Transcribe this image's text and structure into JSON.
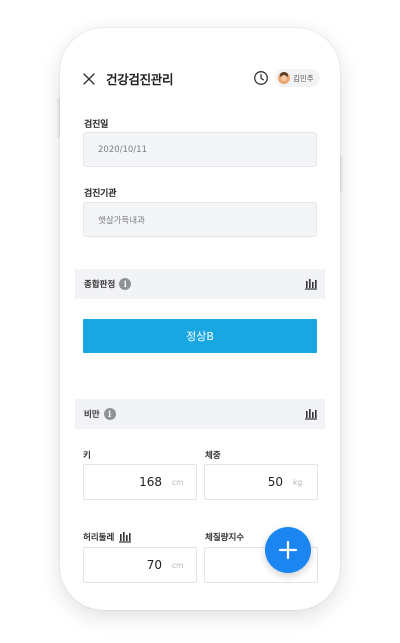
{
  "header": {
    "title": "건강검진관리",
    "user_name": "김민주"
  },
  "form": {
    "exam_date": {
      "label": "검진일",
      "value": "2020/10/11"
    },
    "institution": {
      "label": "검진기관",
      "value": "햇살가득내과"
    }
  },
  "overall": {
    "section_title": "종합판정",
    "result_label": "정상B"
  },
  "obesity": {
    "section_title": "비만",
    "height": {
      "label": "키",
      "value": "168",
      "unit": "cm"
    },
    "weight": {
      "label": "체중",
      "value": "50",
      "unit": "kg"
    },
    "waist": {
      "label": "허리둘레",
      "value": "70",
      "unit": "cm"
    },
    "bmi": {
      "label": "체질량지수",
      "value": "",
      "unit": ""
    }
  },
  "colors": {
    "primary": "#19a7e2",
    "fab": "#1b86f2",
    "section_bg": "#f2f3f7"
  },
  "icons": [
    "close-icon",
    "clock-icon",
    "avatar",
    "info-icon",
    "bar-chart-icon",
    "plus-icon"
  ]
}
